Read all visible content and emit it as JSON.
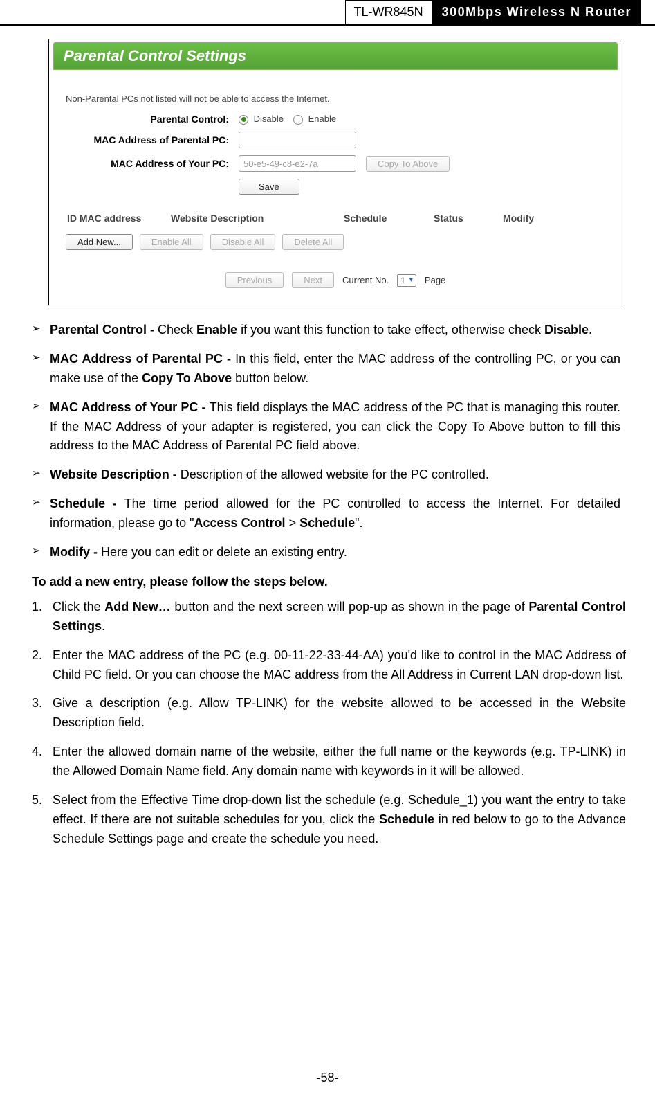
{
  "header": {
    "model": "TL-WR845N",
    "tagline": "300Mbps Wireless N Router"
  },
  "panel": {
    "title": "Parental Control Settings",
    "note": "Non-Parental PCs not listed will not be able to access the Internet.",
    "label_parental_control": "Parental Control:",
    "radio_disable": "Disable",
    "radio_enable": "Enable",
    "label_mac_parental": "MAC Address of Parental PC:",
    "label_mac_your": "MAC Address of Your PC:",
    "mac_value": "50-e5-49-c8-e2-7a",
    "btn_copy": "Copy To Above",
    "btn_save": "Save",
    "col_id_mac": "ID  MAC address",
    "col_desc": "Website Description",
    "col_schedule": "Schedule",
    "col_status": "Status",
    "col_modify": "Modify",
    "btn_add": "Add New...",
    "btn_enable_all": "Enable All",
    "btn_disable_all": "Disable All",
    "btn_delete_all": "Delete All",
    "btn_prev": "Previous",
    "btn_next": "Next",
    "current_no_label": "Current No.",
    "current_no_value": "1",
    "page_label": "Page"
  },
  "bullets": [
    {
      "bold": "Parental Control - ",
      "rest_pre": "Check ",
      "bold2": "Enable",
      "rest_mid": " if you want this function to take effect, otherwise check ",
      "bold3": "Disable",
      "rest_end": "."
    },
    {
      "bold": "MAC Address of Parental PC - ",
      "rest_pre": "In this field, enter the MAC address of the controlling PC, or you can make use of the ",
      "bold2": "Copy To Above",
      "rest_mid": " button below.",
      "bold3": "",
      "rest_end": ""
    },
    {
      "bold": "MAC Address of Your PC - ",
      "rest_pre": "This field displays the MAC address of the PC that is managing this router. If the MAC Address of your adapter is registered, you can click the Copy To Above button to fill this address to the MAC Address of Parental PC field above.",
      "bold2": "",
      "rest_mid": "",
      "bold3": "",
      "rest_end": ""
    },
    {
      "bold": "Website Description - ",
      "rest_pre": "Description of the allowed website for the PC controlled.",
      "bold2": "",
      "rest_mid": "",
      "bold3": "",
      "rest_end": ""
    },
    {
      "bold": "Schedule - ",
      "rest_pre": "The time period allowed for the PC controlled to access the Internet. For detailed information, please go to \"",
      "bold2": "Access Control",
      "rest_mid": "  >  ",
      "bold3": "Schedule",
      "rest_end": "\"."
    },
    {
      "bold": "Modify - ",
      "rest_pre": "Here you can edit or delete an existing entry.",
      "bold2": "",
      "rest_mid": "",
      "bold3": "",
      "rest_end": ""
    }
  ],
  "steps_heading": "To add a new entry, please follow the steps below.",
  "steps": [
    {
      "n": "1.",
      "pre": "Click the ",
      "b1": "Add New…",
      "mid": " button and the next screen will pop-up as shown in the page of ",
      "b2": "Parental Control Settings",
      "end": "."
    },
    {
      "n": "2.",
      "pre": "Enter the MAC address of the PC (e.g. 00-11-22-33-44-AA) you'd like to control in the MAC Address of Child PC field. Or you can choose the MAC address from the All Address in Current LAN drop-down list.",
      "b1": "",
      "mid": "",
      "b2": "",
      "end": ""
    },
    {
      "n": "3.",
      "pre": "Give a description (e.g. Allow TP-LINK) for the website allowed to be accessed in the Website Description field.",
      "b1": "",
      "mid": "",
      "b2": "",
      "end": ""
    },
    {
      "n": "4.",
      "pre": "Enter the allowed domain name of the website, either the full name or the keywords (e.g. TP-LINK) in the Allowed Domain Name field. Any domain name with keywords in it  will be allowed.",
      "b1": "",
      "mid": "",
      "b2": "",
      "end": ""
    },
    {
      "n": "5.",
      "pre": "Select from the Effective Time drop-down list the schedule (e.g. Schedule_1) you want the entry to take effect. If there are not suitable schedules for you, click the ",
      "b1": "Schedule",
      "mid": " in red below to go to the Advance Schedule Settings page and create the schedule you need.",
      "b2": "",
      "end": ""
    }
  ],
  "page_number": "-58-"
}
